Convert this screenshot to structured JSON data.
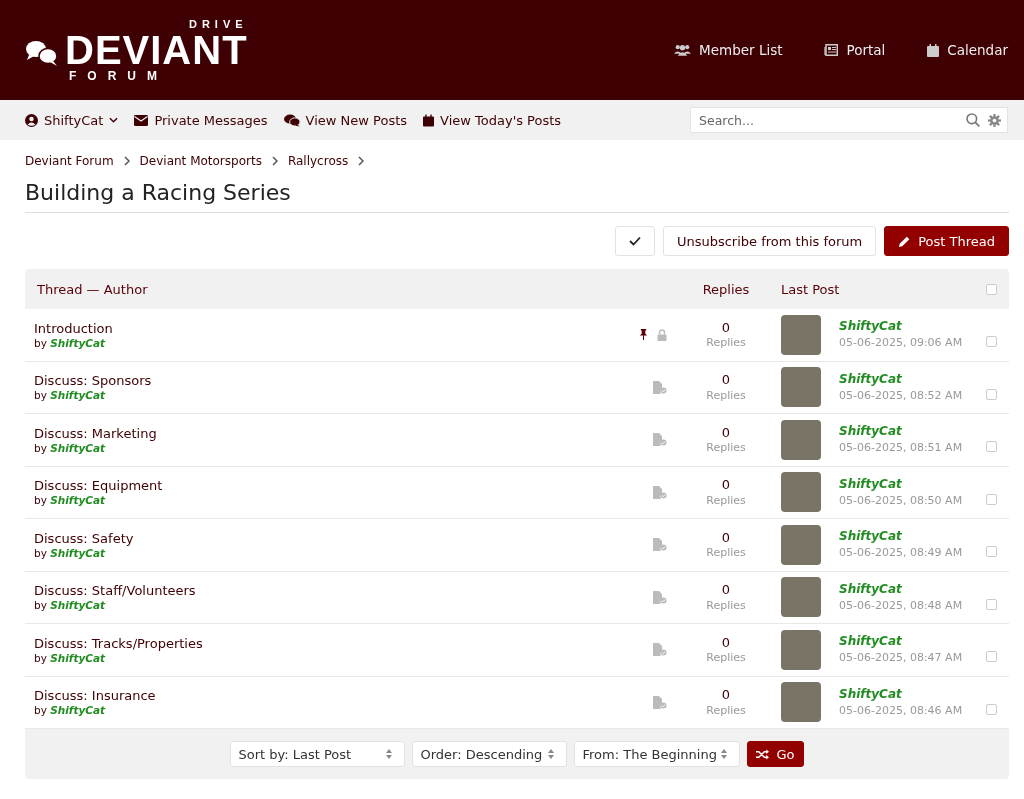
{
  "logo": {
    "top": "DRIVE",
    "main": "DEVIANT",
    "bottom": "FORUM"
  },
  "header_links": [
    {
      "label": "Member List",
      "kind": "members"
    },
    {
      "label": "Portal",
      "kind": "portal"
    },
    {
      "label": "Calendar",
      "kind": "calendar"
    }
  ],
  "navbar": {
    "user": "ShiftyCat",
    "links": [
      {
        "label": "Private Messages",
        "kind": "mail"
      },
      {
        "label": "View New Posts",
        "kind": "comments"
      },
      {
        "label": "View Today's Posts",
        "kind": "calendar"
      }
    ],
    "search": {
      "placeholder": "Search..."
    }
  },
  "breadcrumbs": [
    "Deviant Forum",
    "Deviant Motorsports",
    "Rallycross"
  ],
  "title": "Building a Racing Series",
  "actions": {
    "subscribe": "Unsubscribe from this forum",
    "post": "Post Thread"
  },
  "table": {
    "columns": [
      "Thread — Author",
      "Replies",
      "Last Post"
    ],
    "select_all_checked": false,
    "rows": [
      {
        "title": "Introduction",
        "by": "by",
        "author": "ShiftyCat",
        "sticky": true,
        "locked": true,
        "replies": "0",
        "replies_label": "Replies",
        "last_user": "ShiftyCat",
        "last_date": "05-06-2025, 09:06 AM",
        "checked": false
      },
      {
        "title": "Discuss: Sponsors",
        "by": "by",
        "author": "ShiftyCat",
        "sticky": false,
        "locked": false,
        "replies": "0",
        "replies_label": "Replies",
        "last_user": "ShiftyCat",
        "last_date": "05-06-2025, 08:52 AM",
        "checked": false
      },
      {
        "title": "Discuss: Marketing",
        "by": "by",
        "author": "ShiftyCat",
        "sticky": false,
        "locked": false,
        "replies": "0",
        "replies_label": "Replies",
        "last_user": "ShiftyCat",
        "last_date": "05-06-2025, 08:51 AM",
        "checked": false
      },
      {
        "title": "Discuss: Equipment",
        "by": "by",
        "author": "ShiftyCat",
        "sticky": false,
        "locked": false,
        "replies": "0",
        "replies_label": "Replies",
        "last_user": "ShiftyCat",
        "last_date": "05-06-2025, 08:50 AM",
        "checked": false
      },
      {
        "title": "Discuss: Safety",
        "by": "by",
        "author": "ShiftyCat",
        "sticky": false,
        "locked": false,
        "replies": "0",
        "replies_label": "Replies",
        "last_user": "ShiftyCat",
        "last_date": "05-06-2025, 08:49 AM",
        "checked": false
      },
      {
        "title": "Discuss: Staff/Volunteers",
        "by": "by",
        "author": "ShiftyCat",
        "sticky": false,
        "locked": false,
        "replies": "0",
        "replies_label": "Replies",
        "last_user": "ShiftyCat",
        "last_date": "05-06-2025, 08:48 AM",
        "checked": false
      },
      {
        "title": "Discuss: Tracks/Properties",
        "by": "by",
        "author": "ShiftyCat",
        "sticky": false,
        "locked": false,
        "replies": "0",
        "replies_label": "Replies",
        "last_user": "ShiftyCat",
        "last_date": "05-06-2025, 08:47 AM",
        "checked": false
      },
      {
        "title": "Discuss: Insurance",
        "by": "by",
        "author": "ShiftyCat",
        "sticky": false,
        "locked": false,
        "replies": "0",
        "replies_label": "Replies",
        "last_user": "ShiftyCat",
        "last_date": "05-06-2025, 08:46 AM",
        "checked": false
      }
    ]
  },
  "footer": {
    "selects": [
      "Sort by: Last Post",
      "Order: Descending",
      "From: The Beginning"
    ],
    "go": "Go"
  }
}
